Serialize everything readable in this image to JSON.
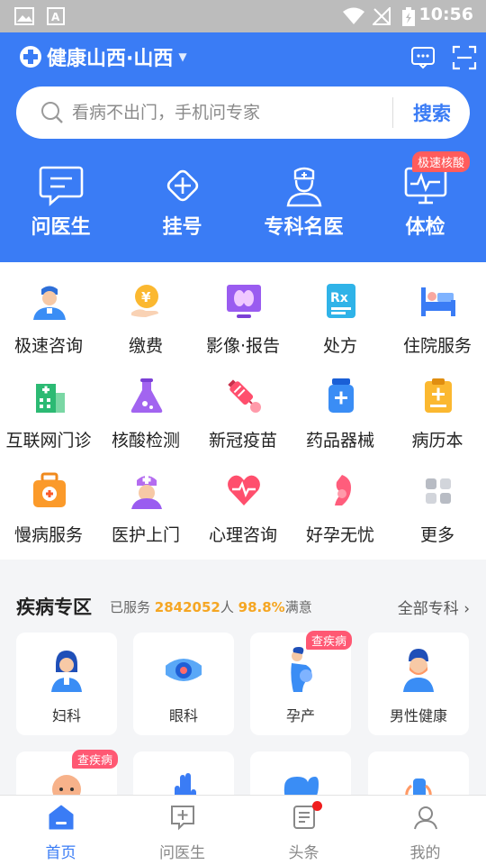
{
  "status_bar": {
    "time": "10:56"
  },
  "header": {
    "app_title": "健康山西·山西",
    "search": {
      "placeholder": "看病不出门，手机问专家",
      "button": "搜索"
    },
    "quick_nav": [
      {
        "label": "问医生",
        "icon": "chat-icon"
      },
      {
        "label": "挂号",
        "icon": "plus-diamond-icon"
      },
      {
        "label": "专科名医",
        "icon": "doctor-icon"
      },
      {
        "label": "体检",
        "icon": "monitor-pulse-icon",
        "badge": "极速核酸"
      }
    ]
  },
  "services": [
    {
      "label": "极速咨询",
      "icon": "nurse-icon"
    },
    {
      "label": "缴费",
      "icon": "coin-hand-icon"
    },
    {
      "label": "影像·报告",
      "icon": "xray-monitor-icon"
    },
    {
      "label": "处方",
      "icon": "prescription-icon"
    },
    {
      "label": "住院服务",
      "icon": "hospital-bed-icon"
    },
    {
      "label": "互联网门诊",
      "icon": "hospital-building-icon"
    },
    {
      "label": "核酸检测",
      "icon": "flask-icon"
    },
    {
      "label": "新冠疫苗",
      "icon": "syringe-icon"
    },
    {
      "label": "药品器械",
      "icon": "medicine-bottle-icon"
    },
    {
      "label": "病历本",
      "icon": "clipboard-icon"
    },
    {
      "label": "慢病服务",
      "icon": "first-aid-kit-icon"
    },
    {
      "label": "医护上门",
      "icon": "nurse-cap-icon"
    },
    {
      "label": "心理咨询",
      "icon": "heart-pulse-icon"
    },
    {
      "label": "好孕无忧",
      "icon": "pregnancy-icon"
    },
    {
      "label": "更多",
      "icon": "grid-icon"
    }
  ],
  "disease_section": {
    "title": "疾病专区",
    "served_prefix": "已服务",
    "served_count": "2842052",
    "served_unit": "人",
    "satisfaction": "98.8%",
    "satisfaction_suffix": "满意",
    "all_link": "全部专科",
    "cards": [
      {
        "label": "妇科",
        "icon": "woman-doctor-icon"
      },
      {
        "label": "眼科",
        "icon": "eye-icon"
      },
      {
        "label": "孕产",
        "icon": "pregnant-woman-icon",
        "badge": "查疾病"
      },
      {
        "label": "男性健康",
        "icon": "man-icon"
      },
      {
        "label": "",
        "icon": "baby-icon",
        "badge": "查疾病"
      },
      {
        "label": "",
        "icon": "hand-icon"
      },
      {
        "label": "",
        "icon": "stomach-icon"
      },
      {
        "label": "",
        "icon": "bone-icon"
      }
    ]
  },
  "tabbar": [
    {
      "label": "首页",
      "icon": "home-icon",
      "active": true
    },
    {
      "label": "问医生",
      "icon": "chat-plus-icon"
    },
    {
      "label": "头条",
      "icon": "document-icon",
      "dot": true
    },
    {
      "label": "我的",
      "icon": "profile-icon"
    }
  ],
  "colors": {
    "brand": "#3a7cf5",
    "highlight": "#f5a623",
    "badge_red": "#ff5c5c"
  }
}
